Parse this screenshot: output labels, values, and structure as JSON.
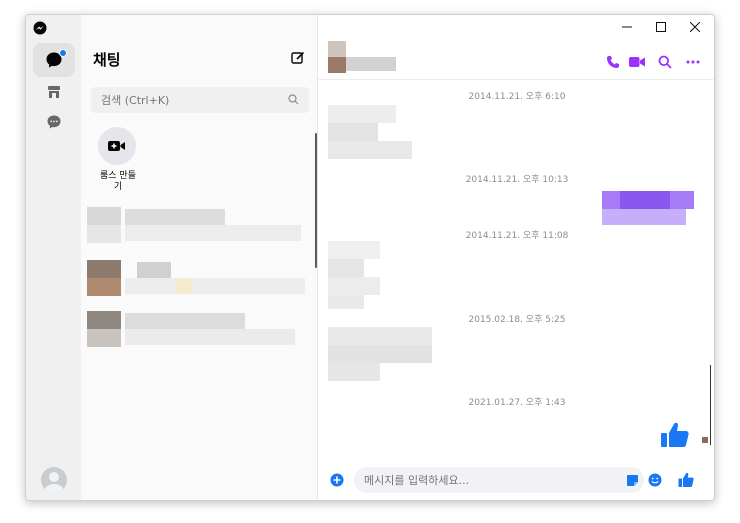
{
  "app": {
    "name": "Messenger",
    "accent": "#9b30ff",
    "brand_blue": "#1877f2"
  },
  "rail": {
    "items": [
      {
        "name": "chats",
        "icon": "chat-bubble-icon",
        "active": true,
        "notification": true
      },
      {
        "name": "marketplace",
        "icon": "store-icon",
        "active": false
      },
      {
        "name": "requests",
        "icon": "message-dots-icon",
        "active": false
      }
    ]
  },
  "sidebar": {
    "title": "채팅",
    "search_placeholder": "검색 (Ctrl+K)",
    "create_room_label": "룸스 만들기"
  },
  "conversation": {
    "timestamps": [
      "2014.11.21. 오후 6:10",
      "2014.11.21. 오후 10:13",
      "2014.11.21. 오후 11:08",
      "2015.02.18. 오후 5:25",
      "2021.01.27. 오후 1:43"
    ]
  },
  "composer": {
    "placeholder": "메시지를 입력하세요..."
  }
}
